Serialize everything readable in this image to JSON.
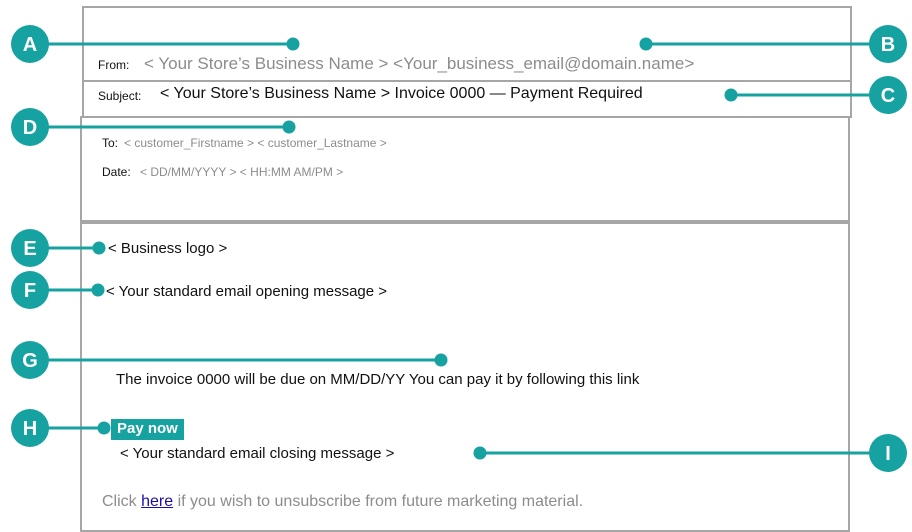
{
  "header": {
    "from_label": "From:",
    "from_value": "< Your Store’s Business Name > <Your_business_email@domain.name>",
    "subject_label": "Subject:",
    "subject_value": "< Your Store’s Business Name > Invoice 0000 — Payment Required"
  },
  "recipient": {
    "to_label": "To:",
    "to_value": "< customer_Firstname > < customer_Lastname >",
    "date_label": "Date:",
    "date_value": "< DD/MM/YYYY > < HH:MM AM/PM >"
  },
  "body": {
    "logo": "< Business logo >",
    "opening": "< Your standard email opening message >",
    "invoice_text": "The invoice 0000 will be due on MM/DD/YY   You can pay it by following this link",
    "pay_button": "Pay now",
    "closing": "< Your standard email closing message >",
    "unsubscribe_prefix": "Click ",
    "unsubscribe_link": "here",
    "unsubscribe_suffix": " if you wish to unsubscribe from future marketing material."
  },
  "callouts": [
    {
      "letter": "A"
    },
    {
      "letter": "B"
    },
    {
      "letter": "C"
    },
    {
      "letter": "D"
    },
    {
      "letter": "E"
    },
    {
      "letter": "F"
    },
    {
      "letter": "G"
    },
    {
      "letter": "H"
    },
    {
      "letter": "I"
    }
  ],
  "colors": {
    "accent": "#17a2a2",
    "border": "#a6a6a6",
    "placeholder": "#8c8c8c"
  }
}
